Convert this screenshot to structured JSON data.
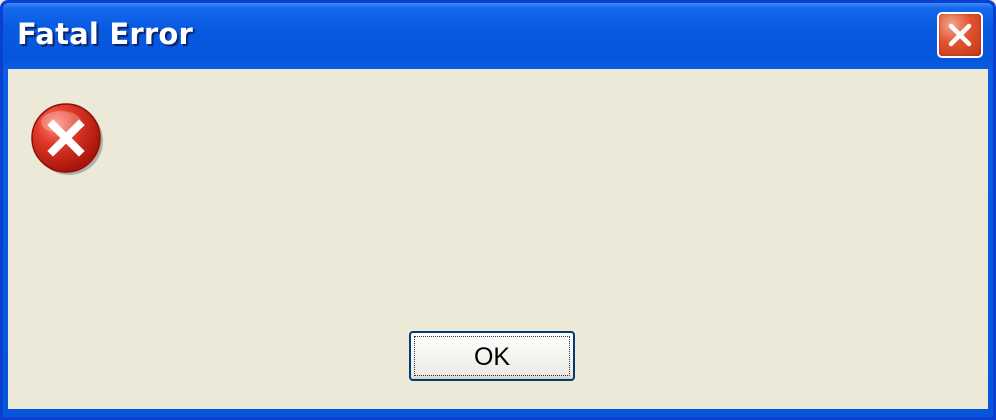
{
  "window": {
    "title": "Fatal Error",
    "close_icon": "close-icon"
  },
  "dialog": {
    "icon": "error-icon",
    "message": "",
    "ok_label": "OK"
  },
  "colors": {
    "titlebar_blue": "#0A5FE6",
    "client_background": "#ECE9D8",
    "close_red": "#E0522E",
    "error_red": "#D0261C",
    "button_border": "#003C74"
  }
}
